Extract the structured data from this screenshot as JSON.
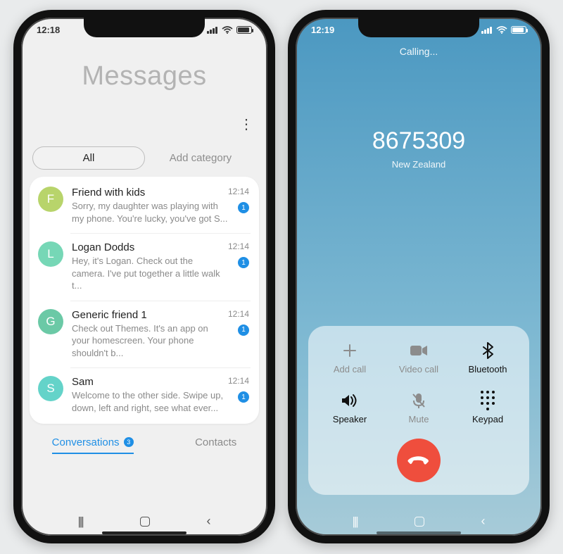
{
  "left": {
    "status": {
      "time": "12:18",
      "location_glyph": "➤"
    },
    "title": "Messages",
    "more_glyph": "⋮",
    "tabs": {
      "all": "All",
      "add_category": "Add category"
    },
    "messages": [
      {
        "initial": "F",
        "color": "#b8d46b",
        "name": "Friend with kids",
        "preview": "Sorry, my daughter was playing with my phone. You're lucky, you've got S...",
        "time": "12:14",
        "unread": "1"
      },
      {
        "initial": "L",
        "color": "#76d7b6",
        "name": "Logan Dodds",
        "preview": "Hey, it's Logan. Check out the camera. I've put together a little walk t...",
        "time": "12:14",
        "unread": "1"
      },
      {
        "initial": "G",
        "color": "#6bc9a6",
        "name": "Generic friend 1",
        "preview": "Check out Themes. It's an app on your homescreen. Your phone shouldn't b...",
        "time": "12:14",
        "unread": "1"
      },
      {
        "initial": "S",
        "color": "#64d3c9",
        "name": "Sam",
        "preview": "Welcome to the other side. Swipe up, down, left and right, see what ever...",
        "time": "12:14",
        "unread": "1"
      }
    ],
    "bottom_tabs": {
      "conversations": "Conversations",
      "conversations_badge": "3",
      "contacts": "Contacts"
    }
  },
  "right": {
    "status": {
      "time": "12:19",
      "location_glyph": "➤"
    },
    "calling_label": "Calling...",
    "number": "8675309",
    "region": "New Zealand",
    "actions": {
      "add_call": "Add call",
      "video_call": "Video call",
      "bluetooth": "Bluetooth",
      "speaker": "Speaker",
      "mute": "Mute",
      "keypad": "Keypad"
    }
  },
  "nav": {
    "recents_glyph": "|||",
    "back_glyph": "‹"
  }
}
